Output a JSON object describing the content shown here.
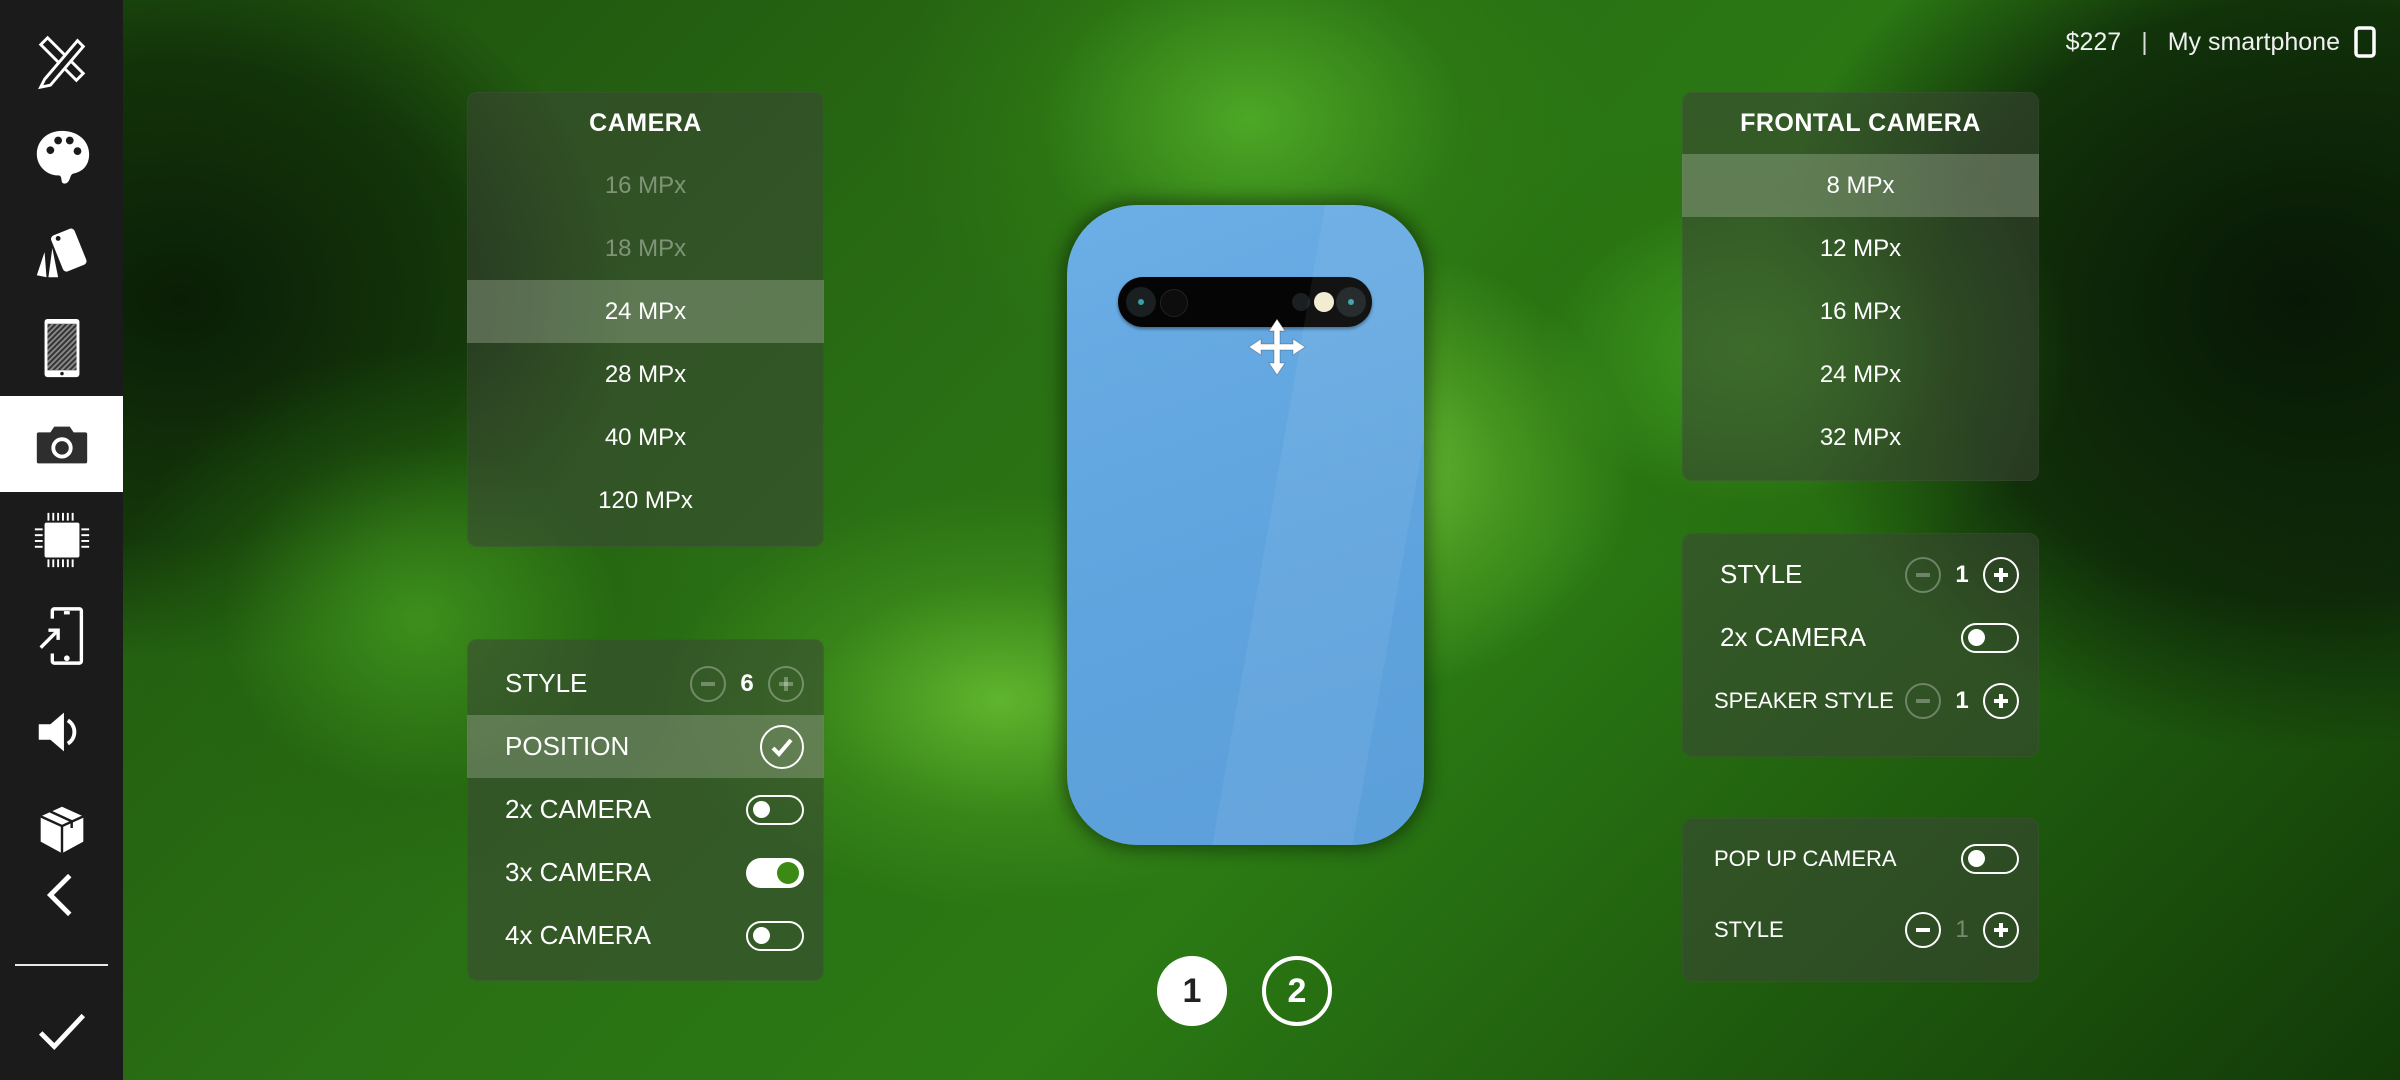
{
  "header": {
    "price": "$227",
    "separator": "|",
    "phone_name": "My smartphone",
    "phone_icon": "smartphone-outline-icon"
  },
  "sidebar": {
    "items": [
      {
        "name": "design-tools",
        "icon": "ruler-pencil-icon",
        "active": false
      },
      {
        "name": "colors",
        "icon": "palette-icon",
        "active": false
      },
      {
        "name": "materials",
        "icon": "swatches-icon",
        "active": false
      },
      {
        "name": "display",
        "icon": "phone-screen-icon",
        "active": false
      },
      {
        "name": "camera",
        "icon": "camera-icon",
        "active": true
      },
      {
        "name": "processor",
        "icon": "chip-icon",
        "active": false
      },
      {
        "name": "ports",
        "icon": "phone-arrow-icon",
        "active": false
      },
      {
        "name": "sound",
        "icon": "speaker-icon",
        "active": false
      },
      {
        "name": "package",
        "icon": "box-icon",
        "active": false
      },
      {
        "name": "back",
        "icon": "chevron-left-icon",
        "active": false
      }
    ],
    "confirm_icon": "checkmark-icon"
  },
  "camera_panel": {
    "title": "CAMERA",
    "options": [
      {
        "label": "16 MPx",
        "state": "disabled"
      },
      {
        "label": "18 MPx",
        "state": "disabled"
      },
      {
        "label": "24 MPx",
        "state": "selected"
      },
      {
        "label": "28 MPx",
        "state": "normal"
      },
      {
        "label": "40 MPx",
        "state": "normal"
      },
      {
        "label": "120 MPx",
        "state": "normal"
      }
    ]
  },
  "camera_settings": {
    "style_label": "STYLE",
    "style_value": "6",
    "position_label": "POSITION",
    "position_checked": true,
    "toggles": [
      {
        "label": "2x CAMERA",
        "on": false
      },
      {
        "label": "3x CAMERA",
        "on": true
      },
      {
        "label": "4x CAMERA",
        "on": false
      }
    ]
  },
  "frontal_panel": {
    "title": "FRONTAL CAMERA",
    "options": [
      {
        "label": "8 MPx",
        "state": "selected"
      },
      {
        "label": "12 MPx",
        "state": "normal"
      },
      {
        "label": "16 MPx",
        "state": "normal"
      },
      {
        "label": "24 MPx",
        "state": "normal"
      },
      {
        "label": "32 MPx",
        "state": "normal"
      }
    ]
  },
  "frontal_settings": {
    "style_label": "STYLE",
    "style_value": "1",
    "dual_label": "2x CAMERA",
    "dual_on": false,
    "speaker_label": "SPEAKER STYLE",
    "speaker_value": "1"
  },
  "popup_settings": {
    "popup_label": "POP UP CAMERA",
    "popup_on": false,
    "style_label": "STYLE",
    "style_value": "1"
  },
  "phone_preview": {
    "body_color": "#62a6e0",
    "move_icon": "move-arrows-icon"
  },
  "pages": {
    "items": [
      "1",
      "2"
    ],
    "active": "1"
  }
}
